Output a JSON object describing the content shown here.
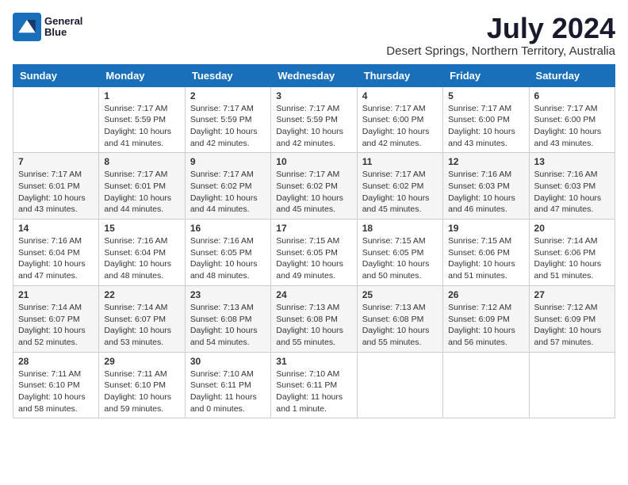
{
  "header": {
    "logo": {
      "line1": "General",
      "line2": "Blue"
    },
    "title": "July 2024",
    "subtitle": "Desert Springs, Northern Territory, Australia"
  },
  "calendar": {
    "days_of_week": [
      "Sunday",
      "Monday",
      "Tuesday",
      "Wednesday",
      "Thursday",
      "Friday",
      "Saturday"
    ],
    "weeks": [
      [
        {
          "day": "",
          "info": ""
        },
        {
          "day": "1",
          "info": "Sunrise: 7:17 AM\nSunset: 5:59 PM\nDaylight: 10 hours\nand 41 minutes."
        },
        {
          "day": "2",
          "info": "Sunrise: 7:17 AM\nSunset: 5:59 PM\nDaylight: 10 hours\nand 42 minutes."
        },
        {
          "day": "3",
          "info": "Sunrise: 7:17 AM\nSunset: 5:59 PM\nDaylight: 10 hours\nand 42 minutes."
        },
        {
          "day": "4",
          "info": "Sunrise: 7:17 AM\nSunset: 6:00 PM\nDaylight: 10 hours\nand 42 minutes."
        },
        {
          "day": "5",
          "info": "Sunrise: 7:17 AM\nSunset: 6:00 PM\nDaylight: 10 hours\nand 43 minutes."
        },
        {
          "day": "6",
          "info": "Sunrise: 7:17 AM\nSunset: 6:00 PM\nDaylight: 10 hours\nand 43 minutes."
        }
      ],
      [
        {
          "day": "7",
          "info": "Sunrise: 7:17 AM\nSunset: 6:01 PM\nDaylight: 10 hours\nand 43 minutes."
        },
        {
          "day": "8",
          "info": "Sunrise: 7:17 AM\nSunset: 6:01 PM\nDaylight: 10 hours\nand 44 minutes."
        },
        {
          "day": "9",
          "info": "Sunrise: 7:17 AM\nSunset: 6:02 PM\nDaylight: 10 hours\nand 44 minutes."
        },
        {
          "day": "10",
          "info": "Sunrise: 7:17 AM\nSunset: 6:02 PM\nDaylight: 10 hours\nand 45 minutes."
        },
        {
          "day": "11",
          "info": "Sunrise: 7:17 AM\nSunset: 6:02 PM\nDaylight: 10 hours\nand 45 minutes."
        },
        {
          "day": "12",
          "info": "Sunrise: 7:16 AM\nSunset: 6:03 PM\nDaylight: 10 hours\nand 46 minutes."
        },
        {
          "day": "13",
          "info": "Sunrise: 7:16 AM\nSunset: 6:03 PM\nDaylight: 10 hours\nand 47 minutes."
        }
      ],
      [
        {
          "day": "14",
          "info": "Sunrise: 7:16 AM\nSunset: 6:04 PM\nDaylight: 10 hours\nand 47 minutes."
        },
        {
          "day": "15",
          "info": "Sunrise: 7:16 AM\nSunset: 6:04 PM\nDaylight: 10 hours\nand 48 minutes."
        },
        {
          "day": "16",
          "info": "Sunrise: 7:16 AM\nSunset: 6:05 PM\nDaylight: 10 hours\nand 48 minutes."
        },
        {
          "day": "17",
          "info": "Sunrise: 7:15 AM\nSunset: 6:05 PM\nDaylight: 10 hours\nand 49 minutes."
        },
        {
          "day": "18",
          "info": "Sunrise: 7:15 AM\nSunset: 6:05 PM\nDaylight: 10 hours\nand 50 minutes."
        },
        {
          "day": "19",
          "info": "Sunrise: 7:15 AM\nSunset: 6:06 PM\nDaylight: 10 hours\nand 51 minutes."
        },
        {
          "day": "20",
          "info": "Sunrise: 7:14 AM\nSunset: 6:06 PM\nDaylight: 10 hours\nand 51 minutes."
        }
      ],
      [
        {
          "day": "21",
          "info": "Sunrise: 7:14 AM\nSunset: 6:07 PM\nDaylight: 10 hours\nand 52 minutes."
        },
        {
          "day": "22",
          "info": "Sunrise: 7:14 AM\nSunset: 6:07 PM\nDaylight: 10 hours\nand 53 minutes."
        },
        {
          "day": "23",
          "info": "Sunrise: 7:13 AM\nSunset: 6:08 PM\nDaylight: 10 hours\nand 54 minutes."
        },
        {
          "day": "24",
          "info": "Sunrise: 7:13 AM\nSunset: 6:08 PM\nDaylight: 10 hours\nand 55 minutes."
        },
        {
          "day": "25",
          "info": "Sunrise: 7:13 AM\nSunset: 6:08 PM\nDaylight: 10 hours\nand 55 minutes."
        },
        {
          "day": "26",
          "info": "Sunrise: 7:12 AM\nSunset: 6:09 PM\nDaylight: 10 hours\nand 56 minutes."
        },
        {
          "day": "27",
          "info": "Sunrise: 7:12 AM\nSunset: 6:09 PM\nDaylight: 10 hours\nand 57 minutes."
        }
      ],
      [
        {
          "day": "28",
          "info": "Sunrise: 7:11 AM\nSunset: 6:10 PM\nDaylight: 10 hours\nand 58 minutes."
        },
        {
          "day": "29",
          "info": "Sunrise: 7:11 AM\nSunset: 6:10 PM\nDaylight: 10 hours\nand 59 minutes."
        },
        {
          "day": "30",
          "info": "Sunrise: 7:10 AM\nSunset: 6:11 PM\nDaylight: 11 hours\nand 0 minutes."
        },
        {
          "day": "31",
          "info": "Sunrise: 7:10 AM\nSunset: 6:11 PM\nDaylight: 11 hours\nand 1 minute."
        },
        {
          "day": "",
          "info": ""
        },
        {
          "day": "",
          "info": ""
        },
        {
          "day": "",
          "info": ""
        }
      ]
    ]
  }
}
